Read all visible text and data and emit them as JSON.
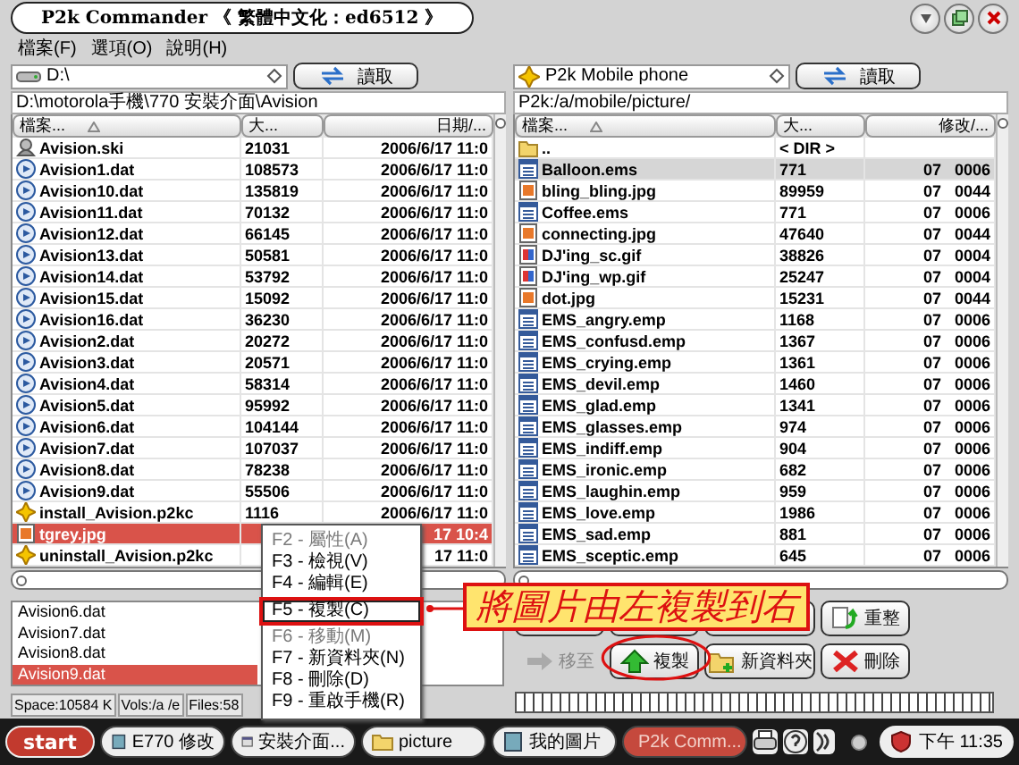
{
  "window": {
    "title": "P2k Commander 《 繁體中文化：ed6512 》"
  },
  "menu": [
    "檔案(F)",
    "選項(O)",
    "說明(H)"
  ],
  "panels": [
    {
      "active": true,
      "drive": "D:\\",
      "read_button": "讀取",
      "path": "D:\\motorola手機\\770 安裝介面\\Avision",
      "columns": [
        {
          "label": "檔案...",
          "sorted": true
        },
        {
          "label": "大...",
          "sorted": false
        },
        {
          "label": "日期/...",
          "sorted": false
        }
      ],
      "rows": [
        {
          "kind": "skin",
          "name": "Avision.ski",
          "size": "21031",
          "info": "2006/6/17 11:0",
          "selected": false
        },
        {
          "kind": "dat",
          "name": "Avision1.dat",
          "size": "108573",
          "info": "2006/6/17 11:0",
          "selected": false
        },
        {
          "kind": "dat",
          "name": "Avision10.dat",
          "size": "135819",
          "info": "2006/6/17 11:0",
          "selected": false
        },
        {
          "kind": "dat",
          "name": "Avision11.dat",
          "size": "70132",
          "info": "2006/6/17 11:0",
          "selected": false
        },
        {
          "kind": "dat",
          "name": "Avision12.dat",
          "size": "66145",
          "info": "2006/6/17 11:0",
          "selected": false
        },
        {
          "kind": "dat",
          "name": "Avision13.dat",
          "size": "50581",
          "info": "2006/6/17 11:0",
          "selected": false
        },
        {
          "kind": "dat",
          "name": "Avision14.dat",
          "size": "53792",
          "info": "2006/6/17 11:0",
          "selected": false
        },
        {
          "kind": "dat",
          "name": "Avision15.dat",
          "size": "15092",
          "info": "2006/6/17 11:0",
          "selected": false
        },
        {
          "kind": "dat",
          "name": "Avision16.dat",
          "size": "36230",
          "info": "2006/6/17 11:0",
          "selected": false
        },
        {
          "kind": "dat",
          "name": "Avision2.dat",
          "size": "20272",
          "info": "2006/6/17 11:0",
          "selected": false
        },
        {
          "kind": "dat",
          "name": "Avision3.dat",
          "size": "20571",
          "info": "2006/6/17 11:0",
          "selected": false
        },
        {
          "kind": "dat",
          "name": "Avision4.dat",
          "size": "58314",
          "info": "2006/6/17 11:0",
          "selected": false
        },
        {
          "kind": "dat",
          "name": "Avision5.dat",
          "size": "95992",
          "info": "2006/6/17 11:0",
          "selected": false
        },
        {
          "kind": "dat",
          "name": "Avision6.dat",
          "size": "104144",
          "info": "2006/6/17 11:0",
          "selected": false
        },
        {
          "kind": "dat",
          "name": "Avision7.dat",
          "size": "107037",
          "info": "2006/6/17 11:0",
          "selected": false
        },
        {
          "kind": "dat",
          "name": "Avision8.dat",
          "size": "78238",
          "info": "2006/6/17 11:0",
          "selected": false
        },
        {
          "kind": "dat",
          "name": "Avision9.dat",
          "size": "55506",
          "info": "2006/6/17 11:0",
          "selected": false
        },
        {
          "kind": "package",
          "name": "install_Avision.p2kc",
          "size": "1116",
          "info": "2006/6/17 11:0",
          "selected": false
        },
        {
          "kind": "image",
          "name": "tgrey.jpg",
          "info": "17 10:4",
          "selected": true
        },
        {
          "kind": "package",
          "name": "uninstall_Avision.p2kc",
          "info": "17 11:0",
          "selected": false
        }
      ]
    },
    {
      "active": false,
      "drive": "P2k Mobile phone",
      "read_button": "讀取",
      "path": "P2k:/a/mobile/picture/",
      "columns": [
        {
          "label": "檔案...",
          "sorted": true
        },
        {
          "label": "大...",
          "sorted": false
        },
        {
          "label": "修改/...",
          "sorted": false
        }
      ],
      "rows": [
        {
          "kind": "folder",
          "name": "..",
          "size": "< DIR >",
          "selected": false
        },
        {
          "kind": "message",
          "name": "Balloon.ems",
          "size": "771",
          "info": "07   0006",
          "selected": true
        },
        {
          "kind": "image",
          "name": "bling_bling.jpg",
          "size": "89959",
          "info": "07   0044",
          "selected": false
        },
        {
          "kind": "message",
          "name": "Coffee.ems",
          "size": "771",
          "info": "07   0006",
          "selected": false
        },
        {
          "kind": "image",
          "name": "connecting.jpg",
          "size": "47640",
          "info": "07   0044",
          "selected": false
        },
        {
          "kind": "animation",
          "name": "DJ'ing_sc.gif",
          "size": "38826",
          "info": "07   0004",
          "selected": false
        },
        {
          "kind": "animation",
          "name": "DJ'ing_wp.gif",
          "size": "25247",
          "info": "07   0004",
          "selected": false
        },
        {
          "kind": "image",
          "name": "dot.jpg",
          "size": "15231",
          "info": "07   0044",
          "selected": false
        },
        {
          "kind": "message",
          "name": "EMS_angry.emp",
          "size": "1168",
          "info": "07   0006",
          "selected": false
        },
        {
          "kind": "message",
          "name": "EMS_confusd.emp",
          "size": "1367",
          "info": "07   0006",
          "selected": false
        },
        {
          "kind": "message",
          "name": "EMS_crying.emp",
          "size": "1361",
          "info": "07   0006",
          "selected": false
        },
        {
          "kind": "message",
          "name": "EMS_devil.emp",
          "size": "1460",
          "info": "07   0006",
          "selected": false
        },
        {
          "kind": "message",
          "name": "EMS_glad.emp",
          "size": "1341",
          "info": "07   0006",
          "selected": false
        },
        {
          "kind": "message",
          "name": "EMS_glasses.emp",
          "size": "974",
          "info": "07   0006",
          "selected": false
        },
        {
          "kind": "message",
          "name": "EMS_indiff.emp",
          "size": "904",
          "info": "07   0006",
          "selected": false
        },
        {
          "kind": "message",
          "name": "EMS_ironic.emp",
          "size": "682",
          "info": "07   0006",
          "selected": false
        },
        {
          "kind": "message",
          "name": "EMS_laughin.emp",
          "size": "959",
          "info": "07   0006",
          "selected": false
        },
        {
          "kind": "message",
          "name": "EMS_love.emp",
          "size": "1986",
          "info": "07   0006",
          "selected": false
        },
        {
          "kind": "message",
          "name": "EMS_sad.emp",
          "size": "881",
          "info": "07   0006",
          "selected": false
        },
        {
          "kind": "message",
          "name": "EMS_sceptic.emp",
          "size": "645",
          "info": "07   0006",
          "selected": false
        }
      ]
    }
  ],
  "queue": [
    {
      "name": "Avision6.dat",
      "selected": false
    },
    {
      "name": "Avision7.dat",
      "selected": false
    },
    {
      "name": "Avision8.dat",
      "selected": false
    },
    {
      "name": "Avision9.dat",
      "selected": true
    }
  ],
  "status_bar": [
    "Space:10584 K",
    "Vols:/a /e",
    "Files:58"
  ],
  "action_rows": [
    [
      {
        "kind": "view",
        "disabled": false
      },
      {
        "kind": "edit",
        "disabled": false
      },
      {
        "kind": "props",
        "disabled": false
      },
      {
        "kind": "refresh",
        "label": "重整",
        "disabled": false
      }
    ],
    [
      {
        "kind": "move",
        "label": "移至",
        "disabled": true
      },
      {
        "kind": "copy",
        "label": "複製",
        "disabled": false
      },
      {
        "kind": "newfolder",
        "label": "新資料夾",
        "disabled": false
      },
      {
        "kind": "delete",
        "label": "刪除",
        "disabled": false
      }
    ]
  ],
  "context_menu": [
    {
      "label": "F2 - 屬性(A)",
      "disabled": true,
      "selected": false
    },
    {
      "label": "F3 - 檢視(V)",
      "disabled": false,
      "selected": false
    },
    {
      "label": "F4 - 編輯(E)",
      "disabled": false,
      "selected": false
    },
    {
      "label": "F5 - 複製(C)",
      "disabled": false,
      "selected": true
    },
    {
      "label": "F6 - 移動(M)",
      "disabled": true,
      "selected": false
    },
    {
      "label": "F7 - 新資料夾(N)",
      "disabled": false,
      "selected": false
    },
    {
      "label": "F8 - 刪除(D)",
      "disabled": false,
      "selected": false
    },
    {
      "label": "F9 - 重啟手機(R)",
      "disabled": false,
      "selected": false
    }
  ],
  "callout": {
    "text": "將圖片由左複製到右"
  },
  "taskbar": {
    "start": "start",
    "tasks": [
      {
        "kind": "document",
        "label": "E770 修改",
        "active": false
      },
      {
        "kind": "app",
        "label": "安裝介面...",
        "active": false
      },
      {
        "kind": "folder",
        "label": "picture",
        "active": false
      },
      {
        "kind": "document",
        "label": "我的圖片",
        "active": false
      },
      {
        "kind": "star",
        "label": "P2k Comm...",
        "active": true
      }
    ],
    "clock": "下午 11:35"
  }
}
